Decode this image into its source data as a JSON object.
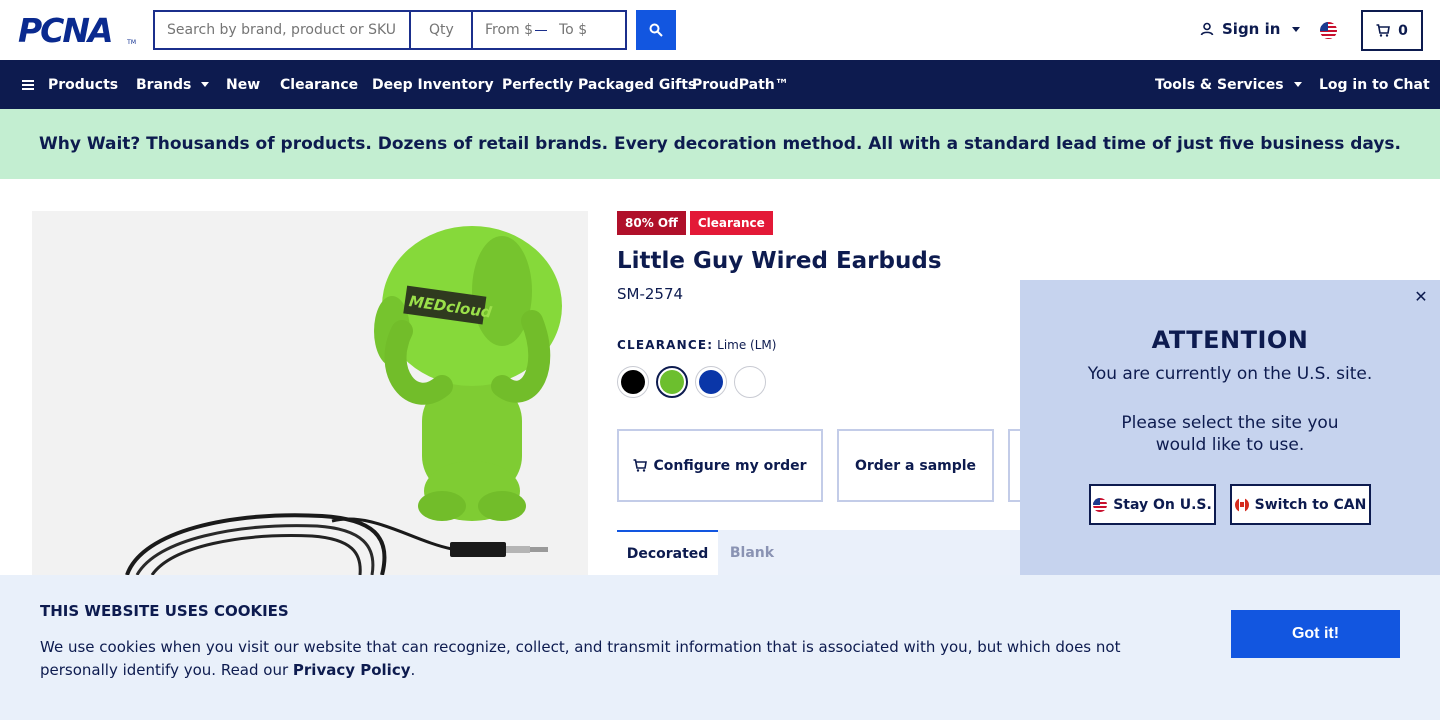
{
  "header": {
    "logo_text": "PCNA",
    "logo_tm": "TM",
    "search_placeholder": "Search by brand, product or SKU",
    "qty_placeholder": "Qty",
    "price_from_placeholder": "From $",
    "price_to_placeholder": "To $",
    "signin_label": "Sign in",
    "cart_count": "0"
  },
  "nav": {
    "products": "Products",
    "brands": "Brands",
    "new": "New",
    "clearance": "Clearance",
    "deep_inventory": "Deep Inventory",
    "gifts": "Perfectly Packaged Gifts",
    "proudpath": "ProudPath™",
    "tools": "Tools & Services",
    "chat": "Log in to Chat"
  },
  "banner": {
    "text": "Why Wait? Thousands of products. Dozens of retail brands. Every decoration method. All with a standard lead time of just five business days."
  },
  "product": {
    "badge_off": "80% Off",
    "badge_clearance": "Clearance",
    "title": "Little Guy Wired Earbuds",
    "sku": "SM-2574",
    "clearance_label": "CLEARANCE:",
    "selected_color": "Lime (LM)",
    "image_logo_text": "MEDcloud",
    "swatches": [
      {
        "color": "#000000"
      },
      {
        "color": "#6cbf2e"
      },
      {
        "color": "#0a36a8"
      },
      {
        "color": "#ffffff"
      }
    ],
    "configure_label": "Configure my order",
    "sample_label": "Order a sample",
    "tab_decorated": "Decorated",
    "tab_blank": "Blank"
  },
  "attention": {
    "title": "ATTENTION",
    "line1": "You are currently on the U.S. site.",
    "line2": "Please select the site you would like to use.",
    "stay_label": "Stay On U.S.",
    "switch_label": "Switch to CAN"
  },
  "cookies": {
    "title": "THIS WEBSITE USES COOKIES",
    "text": "We use cookies when you visit our website that can recognize, collect, and transmit information that is associated with you, but which does not personally identify you. Read our ",
    "policy_link": "Privacy Policy",
    "text_end": ".",
    "button": "Got it!"
  },
  "colors": {
    "navy": "#0d1b4f",
    "brand_blue": "#1256e0",
    "banner_green": "#c3eed1",
    "badge_red": "#e31937",
    "modal_bg": "#c6d3ee"
  }
}
